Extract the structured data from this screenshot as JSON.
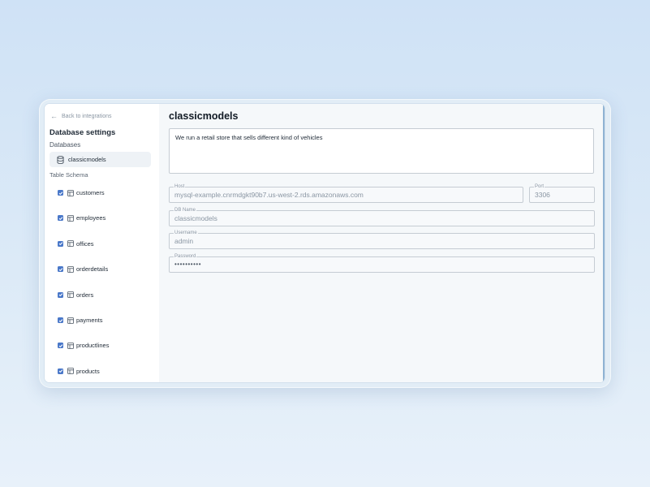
{
  "sidebar": {
    "back_label": "Back to integrations",
    "title": "Database settings",
    "databases_label": "Databases",
    "database_name": "classicmodels",
    "schema_label": "Table Schema",
    "tables": [
      {
        "name": "customers",
        "checked": true
      },
      {
        "name": "employees",
        "checked": true
      },
      {
        "name": "offices",
        "checked": true
      },
      {
        "name": "orderdetails",
        "checked": true
      },
      {
        "name": "orders",
        "checked": true
      },
      {
        "name": "payments",
        "checked": true
      },
      {
        "name": "productlines",
        "checked": true
      },
      {
        "name": "products",
        "checked": true
      }
    ]
  },
  "main": {
    "title": "classicmodels",
    "description": "We run a retail store that sells different kind of vehicles",
    "host_label": "Host",
    "host_value": "mysql-example.cnrmdgkt90b7.us-west-2.rds.amazonaws.com",
    "port_label": "Port",
    "port_value": "3306",
    "dbname_label": "DB Name",
    "dbname_value": "classicmodels",
    "username_label": "Username",
    "username_value": "admin",
    "password_label": "Password",
    "password_value": "••••••••••"
  },
  "colors": {
    "accent": "#4a78c9",
    "background": "#d6e7f7",
    "sidebar_selected": "#eef2f6"
  }
}
